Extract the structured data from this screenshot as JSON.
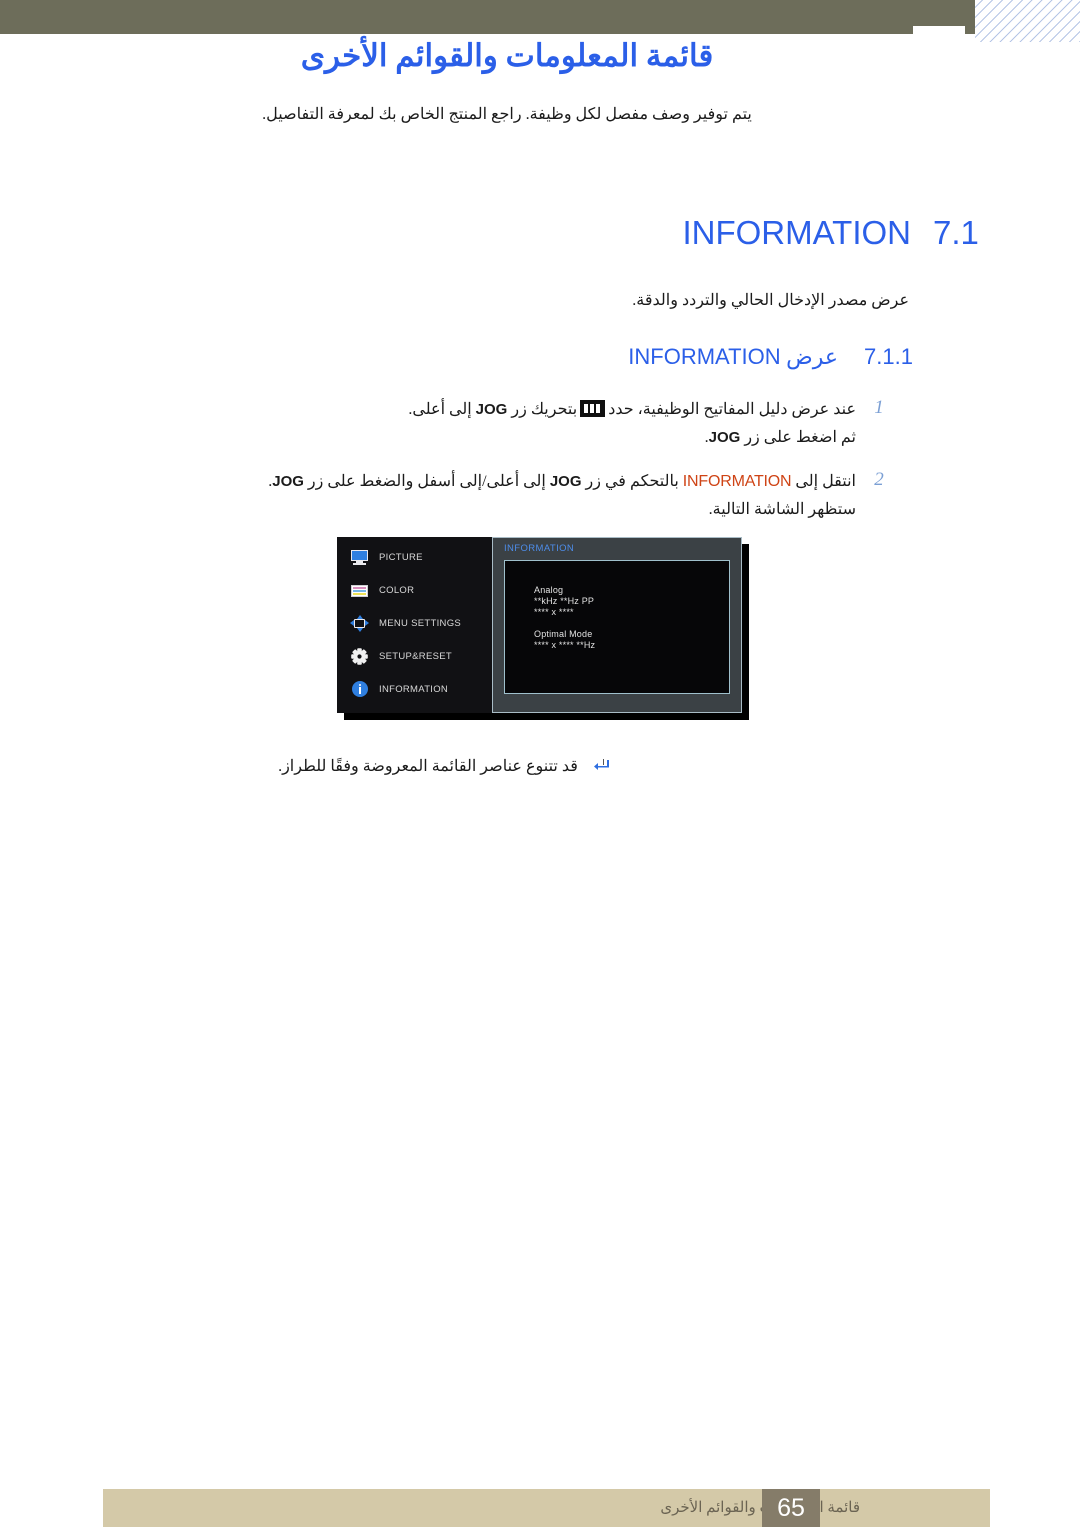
{
  "page": {
    "title": "قائمة المعلومات والقوائم الأخرى",
    "subtitle": "يتم توفير وصف مفصل لكل وظيفة. راجع المنتج الخاص بك لمعرفة التفاصيل."
  },
  "section": {
    "number": "7.1",
    "label": "INFORMATION",
    "description": "عرض مصدر الإدخال الحالي والتردد والدقة."
  },
  "subsection": {
    "number": "7.1.1",
    "label_en": "INFORMATION",
    "label_ar": "عرض"
  },
  "steps": [
    {
      "num": "1",
      "part_a": "عند عرض دليل المفاتيح الوظيفية، حدد",
      "icon": "jog-key-icon",
      "part_b": "بتحريك زر",
      "en_1": "JOG",
      "part_c": "إلى أعلى.",
      "line2_a": "ثم اضغط على زر",
      "line2_en": "JOG",
      "line2_b": "."
    },
    {
      "num": "2",
      "part_a": "انتقل إلى",
      "highlight": "INFORMATION",
      "part_b": "بالتحكم في زر",
      "en_1": "JOG",
      "part_c": "إلى أعلى/إلى أسفل والضغط على زر",
      "en_2": "JOG",
      "part_d": ".",
      "line2": "ستظهر الشاشة التالية."
    }
  ],
  "osd": {
    "menu_items": [
      {
        "icon": "monitor-icon",
        "label": "PICTURE"
      },
      {
        "icon": "color-bars-icon",
        "label": "COLOR"
      },
      {
        "icon": "four-arrows-icon",
        "label": "MENU SETTINGS"
      },
      {
        "icon": "gear-icon",
        "label": "SETUP&RESET"
      },
      {
        "icon": "info-circle-icon",
        "label": "INFORMATION"
      }
    ],
    "panel_title": "INFORMATION",
    "info_lines": [
      "Analog",
      "**kHz **Hz PP",
      "**** x ****",
      "Optimal Mode",
      "**** x **** **Hz"
    ]
  },
  "note": {
    "icon": "note-arrow-icon",
    "text": "قد تتنوع عناصر القائمة المعروضة وفقًا للطراز."
  },
  "footer": {
    "title": "قائمة المعلومات والقوائم الأخرى",
    "page_number": "65"
  },
  "colors": {
    "accent_blue": "#2b5fe8",
    "highlight_orange": "#cf4416",
    "header_band": "#6d6d5a",
    "footer_bar": "#d4c9a8",
    "footer_page_box": "#857c69",
    "osd_menu_bg": "#111114",
    "osd_panel_bg": "#3b4145"
  }
}
